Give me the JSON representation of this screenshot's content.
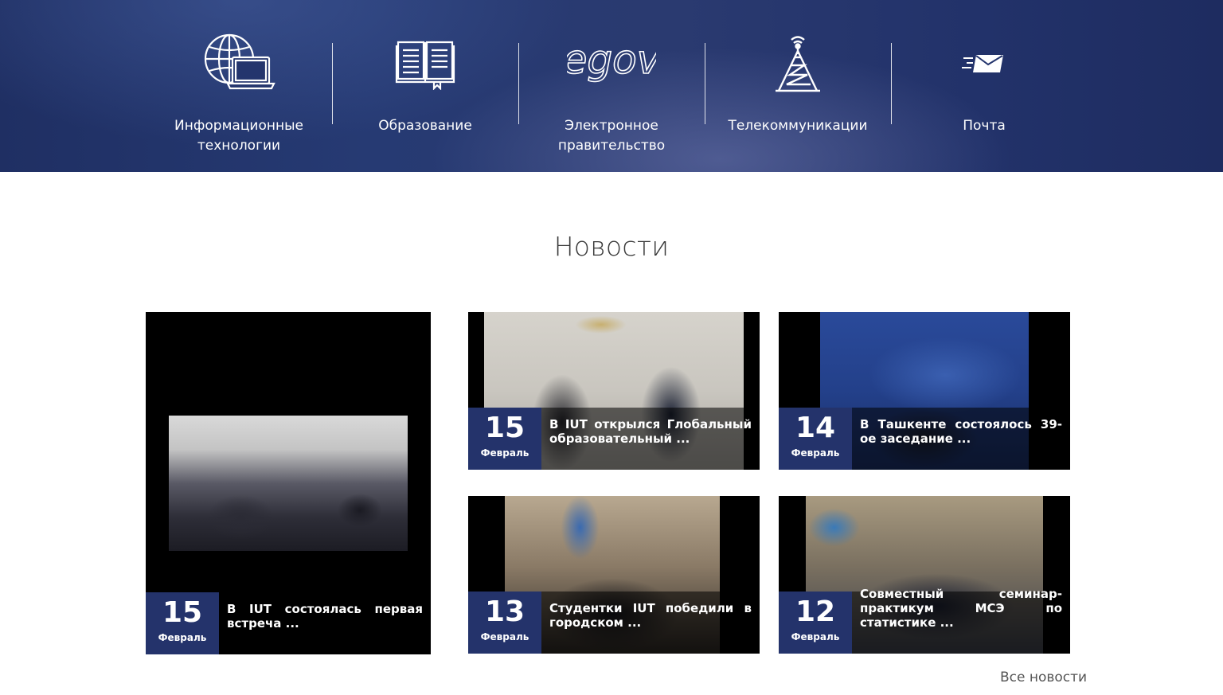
{
  "sectors": [
    {
      "label": "Информационные технологии",
      "icon": "globe-laptop-icon"
    },
    {
      "label": "Образование",
      "icon": "open-book-icon"
    },
    {
      "label": "Электронное правительство",
      "icon": "egov-logo"
    },
    {
      "label": "Телекоммуникации",
      "icon": "radio-tower-icon"
    },
    {
      "label": "Почта",
      "icon": "fast-mail-icon"
    }
  ],
  "egov_logo_text": "egov",
  "news": {
    "title": "Новости",
    "items": [
      {
        "day": "15",
        "month": "Февраль",
        "headline": "В IUT состоялась первая встреча ..."
      },
      {
        "day": "15",
        "month": "Февраль",
        "headline": "В IUT открылся Глобальный образовательный ..."
      },
      {
        "day": "14",
        "month": "Февраль",
        "headline": "В Ташкенте состоялось 39-ое заседание ..."
      },
      {
        "day": "13",
        "month": "Февраль",
        "headline": "Студентки IUT победили в городском ..."
      },
      {
        "day": "12",
        "month": "Февраль",
        "headline": "Совместный семинар-практикум МСЭ по статистике ..."
      }
    ],
    "all_link": "Все новости"
  },
  "colors": {
    "banner": "#22326a",
    "date_box": "#24336b",
    "title_text": "#3a3a3a"
  }
}
